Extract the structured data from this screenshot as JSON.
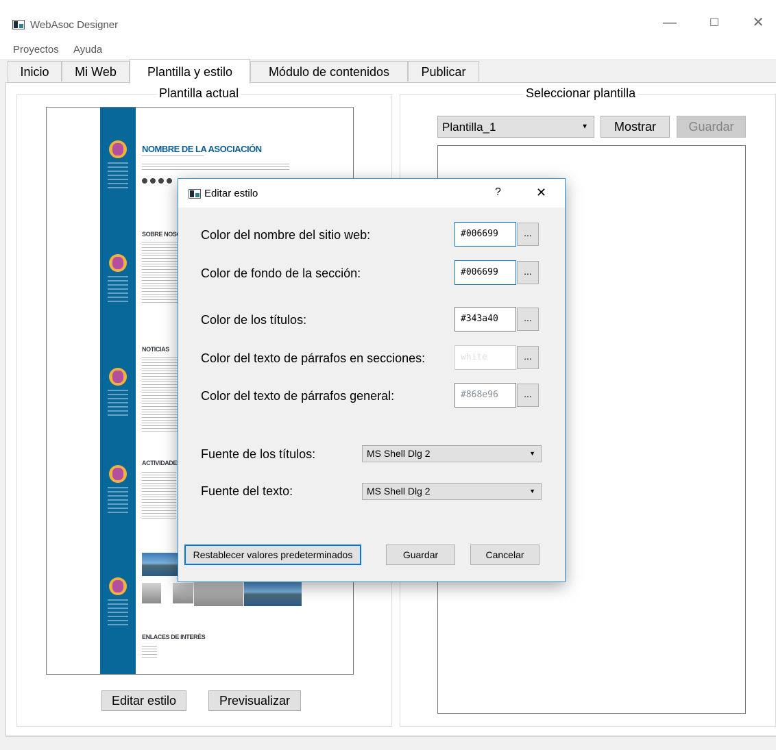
{
  "window": {
    "title": "WebAsoc Designer",
    "minimize": "—",
    "maximize": "☐",
    "close": "✕"
  },
  "menu": {
    "items": [
      "Proyectos",
      "Ayuda"
    ]
  },
  "tabs": [
    "Inicio",
    "Mi Web",
    "Plantilla y estilo",
    "Módulo de contenidos",
    "Publicar"
  ],
  "left_panel": {
    "title": "Plantilla actual",
    "preview": {
      "site_name": "NOMBRE DE LA ASOCIACIÓN",
      "sections": [
        "SOBRE NOSOTROS",
        "NOTICIAS",
        "ACTIVIDADES",
        "ENLACES DE INTERÉS"
      ]
    },
    "edit_button": "Editar estilo",
    "preview_button": "Previsualizar"
  },
  "right_panel": {
    "title": "Seleccionar plantilla",
    "template_select": "Plantilla_1",
    "show_button": "Mostrar",
    "save_button": "Guardar"
  },
  "dialog": {
    "title": "Editar estilo",
    "help": "?",
    "close": "✕",
    "rows": [
      {
        "label": "Color del nombre del sitio web:",
        "value": "#006699"
      },
      {
        "label": "Color de fondo de la sección:",
        "value": "#006699"
      },
      {
        "label": "Color de los títulos:",
        "value": "#343a40"
      },
      {
        "label": "Color del texto de párrafos en secciones:",
        "value": "white"
      },
      {
        "label": "Color del texto de párrafos general:",
        "value": "#868e96"
      }
    ],
    "pick_label": "...",
    "title_font_label": "Fuente de los títulos:",
    "title_font_value": "MS Shell Dlg 2",
    "text_font_label": "Fuente del texto:",
    "text_font_value": "MS Shell Dlg 2",
    "reset_button": "Restablecer valores predeterminados",
    "save_button": "Guardar",
    "cancel_button": "Cancelar"
  },
  "colors": {
    "accent": "#0078d7",
    "site_blue": "#09689a"
  }
}
